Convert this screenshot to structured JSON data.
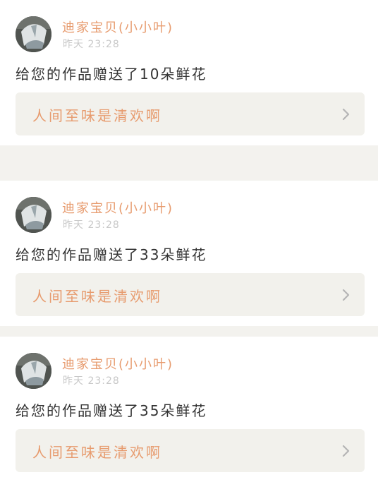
{
  "feed": {
    "items": [
      {
        "user_name": "迪家宝贝(小小叶)",
        "time": "昨天 23:28",
        "message": "给您的作品赠送了33朵鲜花",
        "work_title": "人间至味是清欢啊",
        "avatar_icon": "avatar-image",
        "link_icon": "chevron-right-icon"
      },
      {
        "user_name": "迪家宝贝(小小叶)",
        "time": "昨天 23:28",
        "message": "给您的作品赠送了35朵鲜花",
        "work_title": "人间至味是清欢啊",
        "avatar_icon": "avatar-image",
        "link_icon": "chevron-right-icon"
      },
      {
        "user_name": "迪家宝贝(小小叶)",
        "time": "昨天 23:28",
        "message": "给您的作品赠送了10朵鲜花",
        "work_title": "人间至味是清欢啊",
        "avatar_icon": "avatar-image",
        "link_icon": "chevron-right-icon"
      }
    ]
  },
  "colors": {
    "accent": "#e79b6e",
    "page_background": "#f3f2ee",
    "card_background": "#ffffff",
    "link_background": "#f2f1ec",
    "muted_text": "#c8c8c8",
    "body_text": "#333333"
  }
}
